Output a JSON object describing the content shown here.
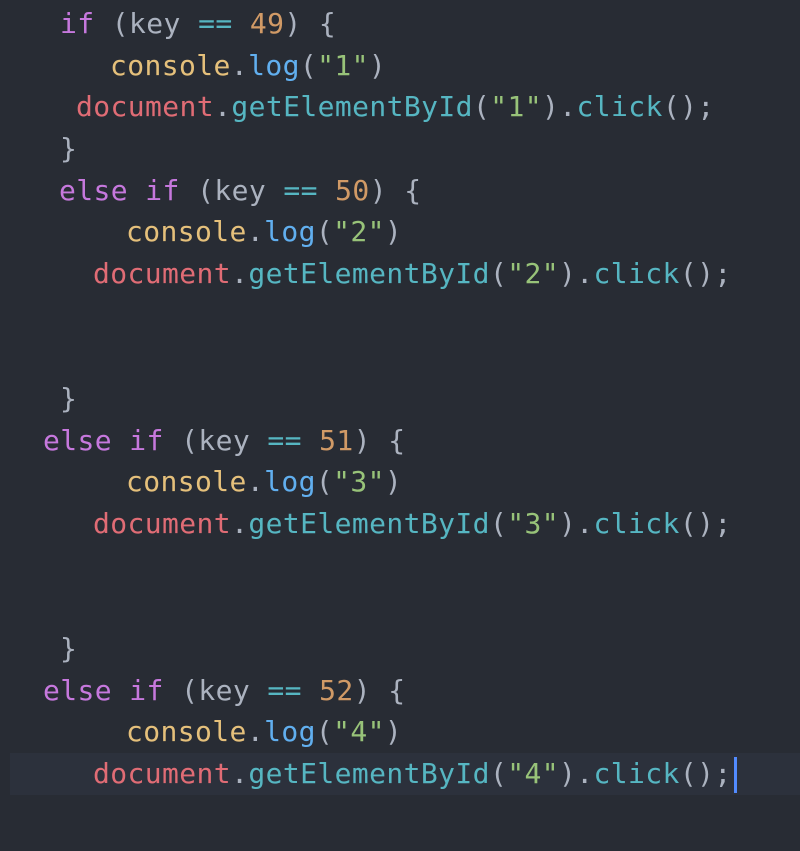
{
  "tokens": {
    "if": "if",
    "else": "else",
    "open_paren": "(",
    "close_paren": ")",
    "key": "key",
    "eqeq": "==",
    "open_brace": "{",
    "close_brace": "}",
    "console": "console",
    "dot": ".",
    "log": "log",
    "document": "document",
    "getElementById": "getElementById",
    "click": "click",
    "call_end": "();"
  },
  "blocks": [
    {
      "key_code": "49",
      "label": "\"1\""
    },
    {
      "key_code": "50",
      "label": "\"2\""
    },
    {
      "key_code": "51",
      "label": "\"3\""
    },
    {
      "key_code": "52",
      "label": "\"4\""
    }
  ],
  "colors": {
    "background": "#282c34",
    "keyword": "#c678dd",
    "number": "#d19a66",
    "string": "#98c379",
    "object": "#e06c75",
    "function": "#61afef",
    "cursor": "#528bff"
  }
}
